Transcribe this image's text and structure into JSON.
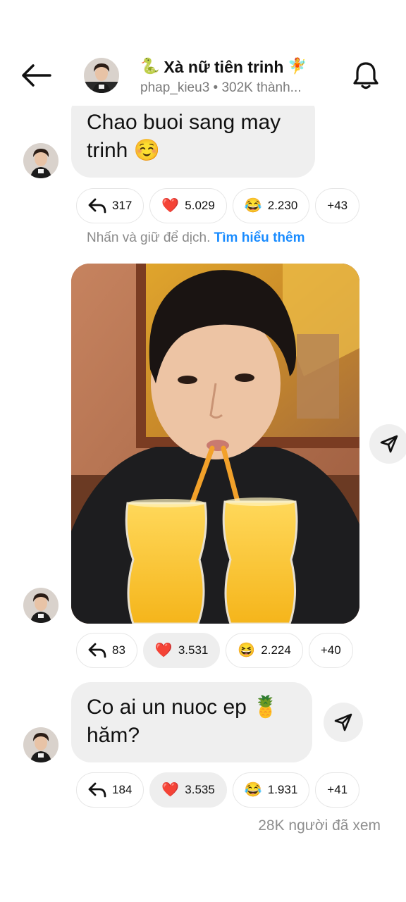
{
  "header": {
    "title_emoji_left": "🐍",
    "title": "Xà nữ tiên trinh",
    "title_emoji_right": "🧚",
    "subtitle": "phap_kieu3 • 302K thành...",
    "back_icon": "arrow-left-icon",
    "bell_icon": "bell-icon"
  },
  "messages": [
    {
      "text": "Chao buoi sang may trinh ☺️",
      "reactions": {
        "reply_count": "317",
        "heart_count": "5.029",
        "laugh_count": "2.230",
        "more": "+43"
      }
    },
    {
      "type": "photo",
      "reactions": {
        "reply_count": "83",
        "heart_count": "3.531",
        "laugh_count": "2.224",
        "more": "+40"
      }
    },
    {
      "text": "Co ai un nuoc ep 🍍 hăm?",
      "reactions": {
        "reply_count": "184",
        "heart_count": "3.535",
        "laugh_count": "1.931",
        "more": "+41"
      }
    }
  ],
  "translate_hint": {
    "text": "Nhấn và giữ để dịch.",
    "link": "Tìm hiểu thêm"
  },
  "views": "28K người đã xem",
  "emojis": {
    "heart": "❤️",
    "laugh_1": "😂",
    "laugh_2": "😆",
    "laugh_3": "😂"
  },
  "colors": {
    "bubble": "#efefef",
    "link": "#1a8cff",
    "muted": "#8a8a8a"
  }
}
